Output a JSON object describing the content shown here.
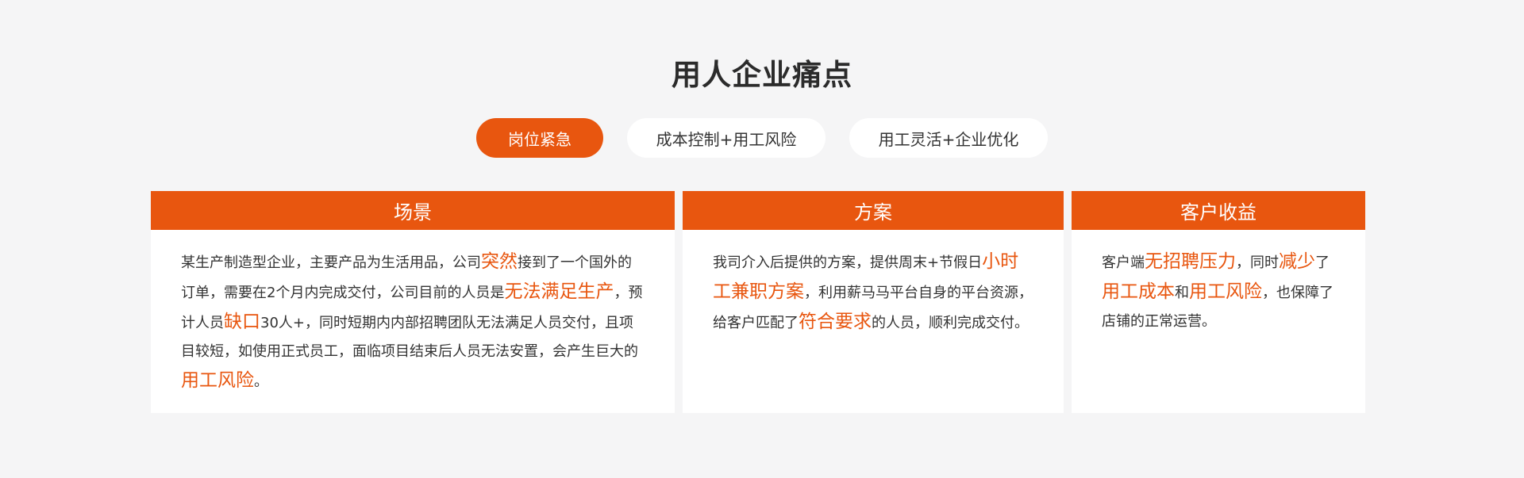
{
  "title": "用人企业痛点",
  "tabs": [
    {
      "label": "岗位紧急",
      "active": true
    },
    {
      "label": "成本控制+用工风险",
      "active": false
    },
    {
      "label": "用工灵活+企业优化",
      "active": false
    }
  ],
  "cards": [
    {
      "heading": "场景",
      "segments": [
        {
          "text": "某生产制造型企业，主要产品为生活用品，公司",
          "hl": false
        },
        {
          "text": "突然",
          "hl": true
        },
        {
          "text": "接到了一个国外的订单，需要在2个月内完成交付，公司目前的人员是",
          "hl": false
        },
        {
          "text": "无法满足生产",
          "hl": true
        },
        {
          "text": "，预计人员",
          "hl": false
        },
        {
          "text": "缺口",
          "hl": true
        },
        {
          "text": "30人+，同时短期内内部招聘团队无法满足人员交付，且项目较短，如使用正式员工，面临项目结束后人员无法安置，会产生巨大的",
          "hl": false
        },
        {
          "text": "用工风险",
          "hl": true
        },
        {
          "text": "。",
          "hl": false
        }
      ]
    },
    {
      "heading": "方案",
      "segments": [
        {
          "text": "我司介入后提供的方案，提供周末+节假日",
          "hl": false
        },
        {
          "text": "小时工兼职方案",
          "hl": true
        },
        {
          "text": "，利用薪马马平台自身的平台资源，给客户匹配了",
          "hl": false
        },
        {
          "text": "符合要求",
          "hl": true
        },
        {
          "text": "的人员，顺利完成交付。",
          "hl": false
        }
      ]
    },
    {
      "heading": "客户收益",
      "segments": [
        {
          "text": "客户端",
          "hl": false
        },
        {
          "text": "无招聘压力",
          "hl": true
        },
        {
          "text": "，同时",
          "hl": false
        },
        {
          "text": "减少",
          "hl": true
        },
        {
          "text": "了",
          "hl": false
        },
        {
          "text": "用工成本",
          "hl": true
        },
        {
          "text": "和",
          "hl": false
        },
        {
          "text": "用工风险",
          "hl": true
        },
        {
          "text": "，也保障了店铺的正常运营。",
          "hl": false
        }
      ]
    }
  ],
  "colors": {
    "accent": "#e8560f",
    "background": "#f5f5f6"
  }
}
